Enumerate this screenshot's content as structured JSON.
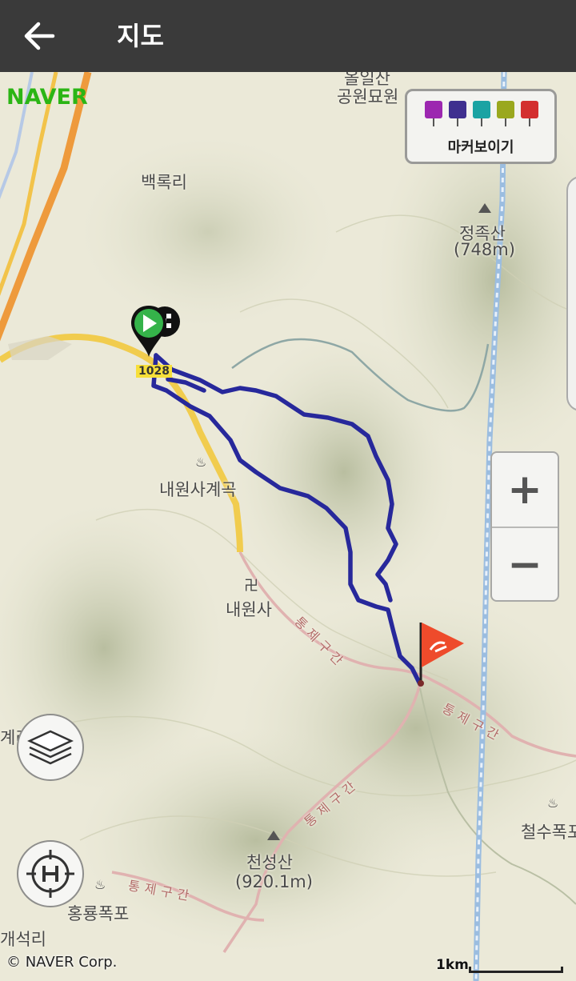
{
  "header": {
    "back_icon": "arrow-left-icon",
    "title": "지도"
  },
  "brand": {
    "logo_text": "NAVER",
    "color": "#2bb515"
  },
  "marker_panel": {
    "label": "마커보이기",
    "icons": [
      {
        "name": "camera-icon",
        "color": "#9c27b0"
      },
      {
        "name": "video-icon",
        "color": "#3f2f8f"
      },
      {
        "name": "pencil-icon",
        "color": "#1aa3a3"
      },
      {
        "name": "note-icon",
        "color": "#9aa81e"
      },
      {
        "name": "flag-icon",
        "color": "#d32f2f"
      }
    ]
  },
  "map_labels": {
    "top_park": "공원묘원",
    "top_park_partial": "올일산",
    "baekrok": "백록리",
    "jeongjok_name": "정족산",
    "jeongjok_alt": "(748m)",
    "road_no": "1028",
    "naewonsa_valley": "내원사계곡",
    "naewonsa": "내원사",
    "cheonseong_name": "천성산",
    "cheonseong_alt": "(920.1m)",
    "hongnyong": "홍룡폭포",
    "cheolsu": "철수폭포",
    "left_edge_1": "계리",
    "left_edge_2": "개석리",
    "trail_1": "통제구간",
    "trail_2": "통제구간",
    "trail_3": "통제구간",
    "trail_4": "통제구간"
  },
  "controls": {
    "zoom_in_label": "+",
    "zoom_out_label": "−",
    "layers_icon": "layers-icon",
    "heliport_icon": "heliport-icon"
  },
  "footer": {
    "copyright": "© NAVER Corp.",
    "scale_label": "1km"
  },
  "colors": {
    "route": "#27289b",
    "start_marker": "#35b34a",
    "end_flag": "#ee4b2b"
  }
}
